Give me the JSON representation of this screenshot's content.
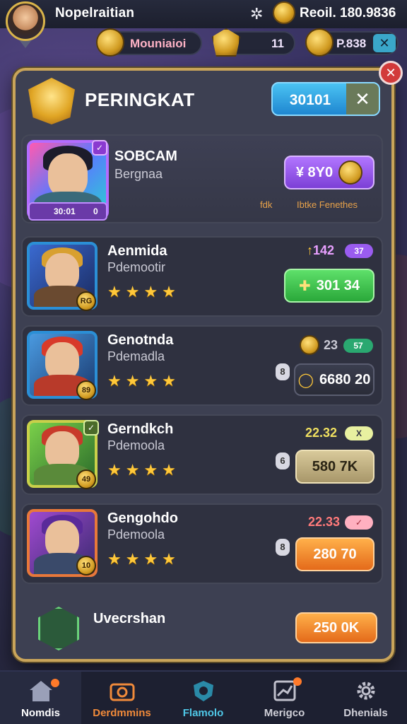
{
  "player": {
    "name": "Nopelraitian",
    "currency_display": "Reoil. 180.9836"
  },
  "resources": [
    {
      "label": "Mouniaioi"
    },
    {
      "label": "11"
    },
    {
      "label": "P.838"
    }
  ],
  "panel": {
    "title": "PERINGKAT",
    "header_button": "30101"
  },
  "featured": {
    "name": "SOBCAM",
    "subtitle": "Bergnaa",
    "reward": "¥ 8Y0",
    "badge_text": "30:01",
    "badge_level": "0",
    "small_left": "fdk",
    "small_right": "Ibtke Fenethes"
  },
  "entries": [
    {
      "name": "Aenmida",
      "subtitle": "Pdemootir",
      "level": "RG",
      "value": "142",
      "value_prefix": "↑",
      "reward": "301 34",
      "style": "green",
      "pill": "37"
    },
    {
      "name": "Genotnda",
      "subtitle": "Pdemadla",
      "level": "89",
      "value": "23",
      "value_prefix": "",
      "reward": "6680 20",
      "style": "dark",
      "pill": "57",
      "side": "8"
    },
    {
      "name": "Gerndkch",
      "subtitle": "Pdemoola",
      "level": "49",
      "value": "22.32",
      "value_prefix": "",
      "reward": "580 7K",
      "style": "olive",
      "pill": "X",
      "side": "6"
    },
    {
      "name": "Gengohdo",
      "subtitle": "Pdemoola",
      "level": "10",
      "value": "22.33",
      "value_prefix": "",
      "reward": "280 70",
      "style": "orange",
      "pill": "",
      "side": "8"
    }
  ],
  "self": {
    "name": "Uvecrshan",
    "reward": "250 0K"
  },
  "nav": [
    {
      "label": "Nomdis",
      "icon": "home-icon",
      "color": "#ffffff",
      "active": true
    },
    {
      "label": "Derdmmins",
      "icon": "camera-icon",
      "color": "#f08a3a",
      "active": false
    },
    {
      "label": "Flamolo",
      "icon": "shield-icon",
      "color": "#4fc8e8",
      "active": false
    },
    {
      "label": "Merigco",
      "icon": "chart-icon",
      "color": "#d0d0d8",
      "active": false
    },
    {
      "label": "Dhenials",
      "icon": "gear-icon",
      "color": "#d0d0d8",
      "active": false
    }
  ],
  "colors": {
    "accent_gold": "#c9a45a",
    "purple": "#9a5cf0",
    "green": "#3ec64e",
    "orange": "#f08a2a",
    "blue": "#2b8fd6"
  }
}
